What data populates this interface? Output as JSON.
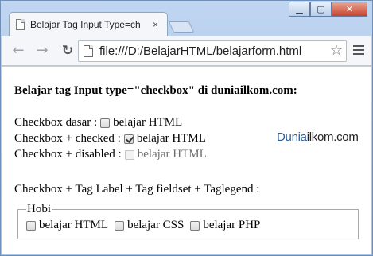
{
  "browser": {
    "tab_title": "Belajar Tag Input Type=ch",
    "tab_close": "×",
    "url": "file:///D:/BelajarHTML/belajarform.html",
    "icons": {
      "back": "back-arrow-icon",
      "forward": "forward-arrow-icon",
      "reload": "reload-icon",
      "star": "star-icon",
      "menu": "hamburger-menu-icon"
    },
    "window_controls": {
      "minimize": "▁",
      "maximize": "▢",
      "close": "✕"
    }
  },
  "page": {
    "heading": "Belajar tag Input type=\"checkbox\" di duniailkom.com:",
    "checkbox_rows": [
      {
        "label": "Checkbox dasar :",
        "option": "belajar HTML",
        "checked": false,
        "disabled": false
      },
      {
        "label": "Checkbox + checked :",
        "option": "belajar HTML",
        "checked": true,
        "disabled": false
      },
      {
        "label": "Checkbox + disabled :",
        "option": "belajar HTML",
        "checked": false,
        "disabled": true
      }
    ],
    "brand": {
      "part1": "Dunia",
      "part2": "ilkom.com",
      "color": "#2f5e9c"
    },
    "fieldset_intro": "Checkbox + Tag Label + Tag fieldset + Taglegend :",
    "fieldset": {
      "legend": "Hobi",
      "options": [
        "belajar HTML",
        "belajar CSS",
        "belajar PHP"
      ]
    }
  }
}
